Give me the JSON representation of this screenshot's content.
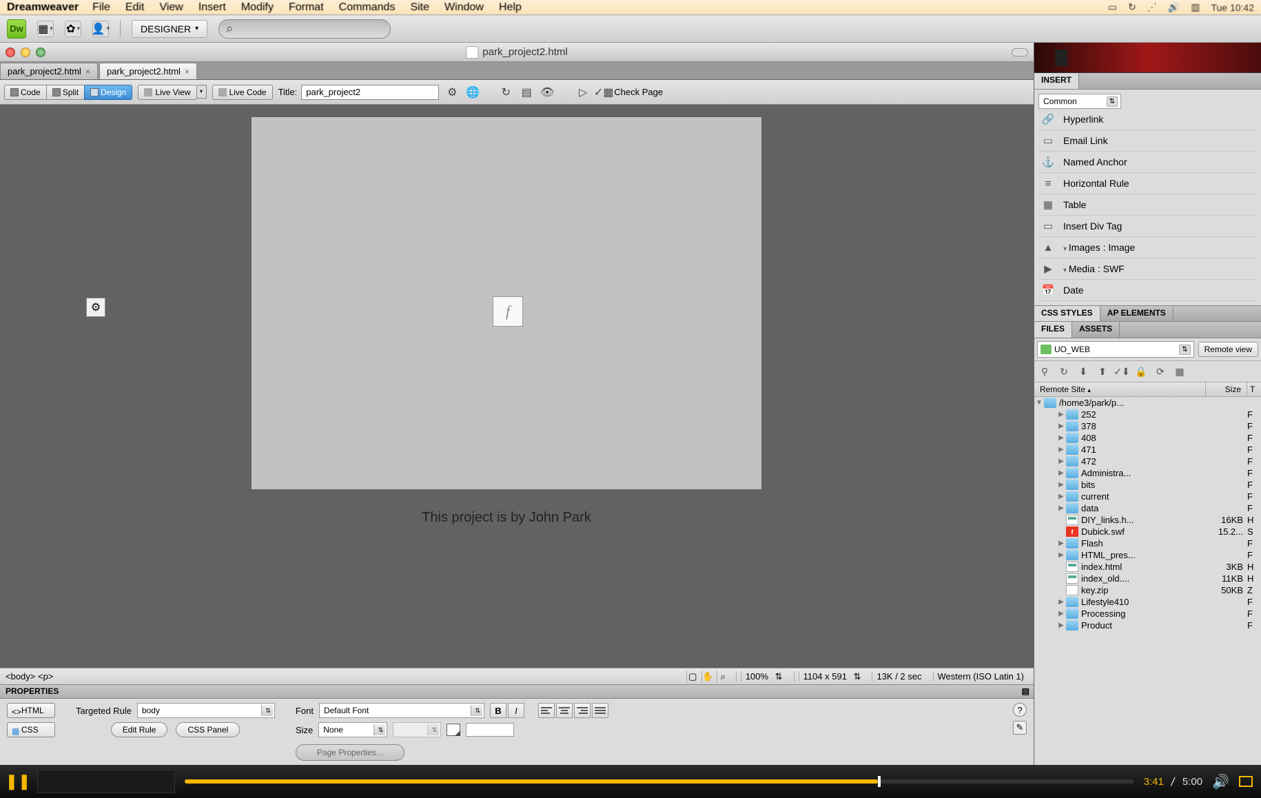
{
  "menubar": {
    "app": "Dreamweaver",
    "items": [
      "File",
      "Edit",
      "View",
      "Insert",
      "Modify",
      "Format",
      "Commands",
      "Site",
      "Window",
      "Help"
    ],
    "clock": "Tue 10:42"
  },
  "toolbar": {
    "workspace": "DESIGNER"
  },
  "document": {
    "filename": "park_project2.html",
    "tabs": [
      "park_project2.html",
      "park_project2.html"
    ],
    "active_tab": 1,
    "views": {
      "code": "Code",
      "split": "Split",
      "design": "Design"
    },
    "live_view": "Live View",
    "live_code": "Live Code",
    "title_label": "Title:",
    "title_value": "park_project2",
    "check_page": "Check Page"
  },
  "canvas": {
    "caption": "This project is by John Park"
  },
  "statusbar": {
    "tags": "<body> <p>",
    "zoom": "100%",
    "dims": "1104 x 591",
    "size_time": "13K / 2 sec",
    "encoding": "Western (ISO Latin 1)"
  },
  "properties": {
    "header": "PROPERTIES",
    "html_btn": "HTML",
    "css_btn": "CSS",
    "targeted_rule_label": "Targeted Rule",
    "targeted_rule_value": "body",
    "edit_rule": "Edit Rule",
    "css_panel": "CSS Panel",
    "font_label": "Font",
    "font_value": "Default Font",
    "size_label": "Size",
    "size_value": "None",
    "page_props": "Page Properties..."
  },
  "insert_panel": {
    "header": "INSERT",
    "category": "Common",
    "items": [
      {
        "label": "Hyperlink",
        "icon": "link"
      },
      {
        "label": "Email Link",
        "icon": "mail"
      },
      {
        "label": "Named Anchor",
        "icon": "anchor"
      },
      {
        "label": "Horizontal Rule",
        "icon": "hr"
      },
      {
        "label": "Table",
        "icon": "table"
      },
      {
        "label": "Insert Div Tag",
        "icon": "div"
      },
      {
        "label": "Images : Image",
        "icon": "image",
        "sub": true
      },
      {
        "label": "Media : SWF",
        "icon": "swf",
        "sub": true
      },
      {
        "label": "Date",
        "icon": "date"
      }
    ]
  },
  "css_styles": {
    "tab1": "CSS STYLES",
    "tab2": "AP ELEMENTS"
  },
  "files_panel": {
    "tab1": "FILES",
    "tab2": "ASSETS",
    "site": "UO_WEB",
    "view_mode": "Remote view",
    "cols": {
      "name": "Remote Site",
      "size": "Size",
      "type": "T"
    },
    "root": "/home3/park/p...",
    "items": [
      {
        "name": "252",
        "type": "folder",
        "indent": 2
      },
      {
        "name": "378",
        "type": "folder",
        "indent": 2
      },
      {
        "name": "408",
        "type": "folder",
        "indent": 2
      },
      {
        "name": "471",
        "type": "folder",
        "indent": 2
      },
      {
        "name": "472",
        "type": "folder",
        "indent": 2
      },
      {
        "name": "Administra...",
        "type": "folder",
        "indent": 2
      },
      {
        "name": "bits",
        "type": "folder",
        "indent": 2
      },
      {
        "name": "current",
        "type": "folder",
        "indent": 2
      },
      {
        "name": "data",
        "type": "folder",
        "indent": 2
      },
      {
        "name": "DIY_links.h...",
        "type": "html",
        "indent": 2,
        "size": "16KB",
        "t": "H"
      },
      {
        "name": "Dubick.swf",
        "type": "swf",
        "indent": 2,
        "size": "15.2...",
        "t": "S"
      },
      {
        "name": "Flash",
        "type": "folder",
        "indent": 2
      },
      {
        "name": "HTML_pres...",
        "type": "folder",
        "indent": 2
      },
      {
        "name": "index.html",
        "type": "html",
        "indent": 2,
        "size": "3KB",
        "t": "H"
      },
      {
        "name": "index_old....",
        "type": "html",
        "indent": 2,
        "size": "11KB",
        "t": "H"
      },
      {
        "name": "key.zip",
        "type": "file",
        "indent": 2,
        "size": "50KB",
        "t": "Z"
      },
      {
        "name": "Lifestyle410",
        "type": "folder",
        "indent": 2
      },
      {
        "name": "Processing",
        "type": "folder",
        "indent": 2
      },
      {
        "name": "Product",
        "type": "folder",
        "indent": 2
      }
    ]
  },
  "video": {
    "current": "3:41",
    "total": "5:00"
  }
}
